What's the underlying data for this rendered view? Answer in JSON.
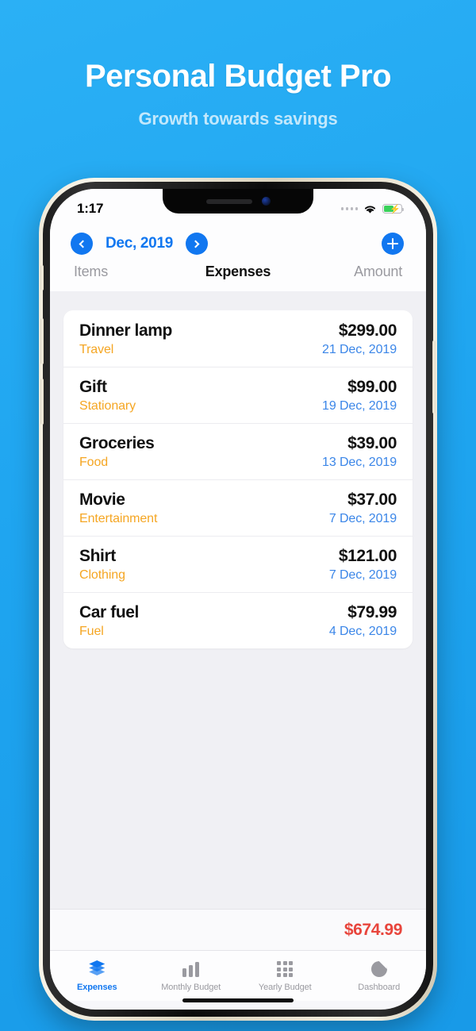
{
  "promo": {
    "title": "Personal Budget Pro",
    "subtitle": "Growth towards savings"
  },
  "status_bar": {
    "time": "1:17",
    "signal_icon": "signal-dots-icon",
    "wifi_icon": "wifi-icon",
    "battery_icon": "battery-charging-icon",
    "battery_level": "58%"
  },
  "nav": {
    "prev_icon": "chevron-left-icon",
    "next_icon": "chevron-right-icon",
    "month_label": "Dec, 2019",
    "add_icon": "plus-icon"
  },
  "column_headers": {
    "left": "Items",
    "center": "Expenses",
    "right": "Amount"
  },
  "expenses": [
    {
      "name": "Dinner lamp",
      "category": "Travel",
      "amount": "$299.00",
      "date": "21 Dec, 2019"
    },
    {
      "name": "Gift",
      "category": "Stationary",
      "amount": "$99.00",
      "date": "19 Dec, 2019"
    },
    {
      "name": "Groceries",
      "category": "Food",
      "amount": "$39.00",
      "date": "13 Dec, 2019"
    },
    {
      "name": "Movie",
      "category": "Entertainment",
      "amount": "$37.00",
      "date": "7 Dec, 2019"
    },
    {
      "name": "Shirt",
      "category": "Clothing",
      "amount": "$121.00",
      "date": "7 Dec, 2019"
    },
    {
      "name": "Car fuel",
      "category": "Fuel",
      "amount": "$79.99",
      "date": "4 Dec, 2019"
    }
  ],
  "total": {
    "amount": "$674.99"
  },
  "tabs": [
    {
      "label": "Expenses",
      "icon": "layers-icon",
      "active": true
    },
    {
      "label": "Monthly Budget",
      "icon": "bar-chart-icon",
      "active": false
    },
    {
      "label": "Yearly Budget",
      "icon": "grid-icon",
      "active": false
    },
    {
      "label": "Dashboard",
      "icon": "pie-chart-icon",
      "active": false
    }
  ],
  "colors": {
    "background_blue": "#1fa5f0",
    "accent_blue": "#1177f0",
    "category_orange": "#f5a623",
    "date_blue": "#3b86e8",
    "total_red": "#e8453c",
    "screen_gray": "#f0f0f4"
  }
}
